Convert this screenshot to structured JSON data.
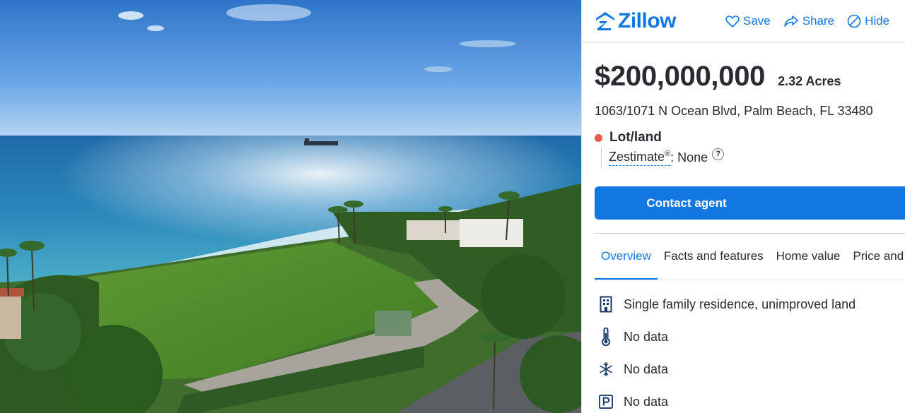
{
  "header": {
    "brand": "Zillow",
    "actions": [
      {
        "label": "Save",
        "icon": "heart-icon"
      },
      {
        "label": "Share",
        "icon": "share-icon"
      },
      {
        "label": "Hide",
        "icon": "hide-icon"
      }
    ]
  },
  "listing": {
    "price": "$200,000,000",
    "acres": "2.32 Acres",
    "address": "1063/1071 N Ocean Blvd, Palm Beach, FL 33480",
    "type": "Lot/land",
    "zestimate_label": "Zestimate",
    "zestimate_mark": "®",
    "zestimate_value": ": None",
    "help": "?"
  },
  "cta": {
    "contact": "Contact agent"
  },
  "tabs": [
    "Overview",
    "Facts and features",
    "Home value",
    "Price and tax history"
  ],
  "facts": [
    {
      "icon": "building-icon",
      "text": "Single family residence, unimproved land"
    },
    {
      "icon": "thermometer-icon",
      "text": "No data"
    },
    {
      "icon": "snowflake-icon",
      "text": "No data"
    },
    {
      "icon": "parking-icon",
      "text": "No data"
    }
  ],
  "colors": {
    "brand": "#1277e1",
    "status_dot": "#e8594a",
    "text": "#2a2a33"
  }
}
